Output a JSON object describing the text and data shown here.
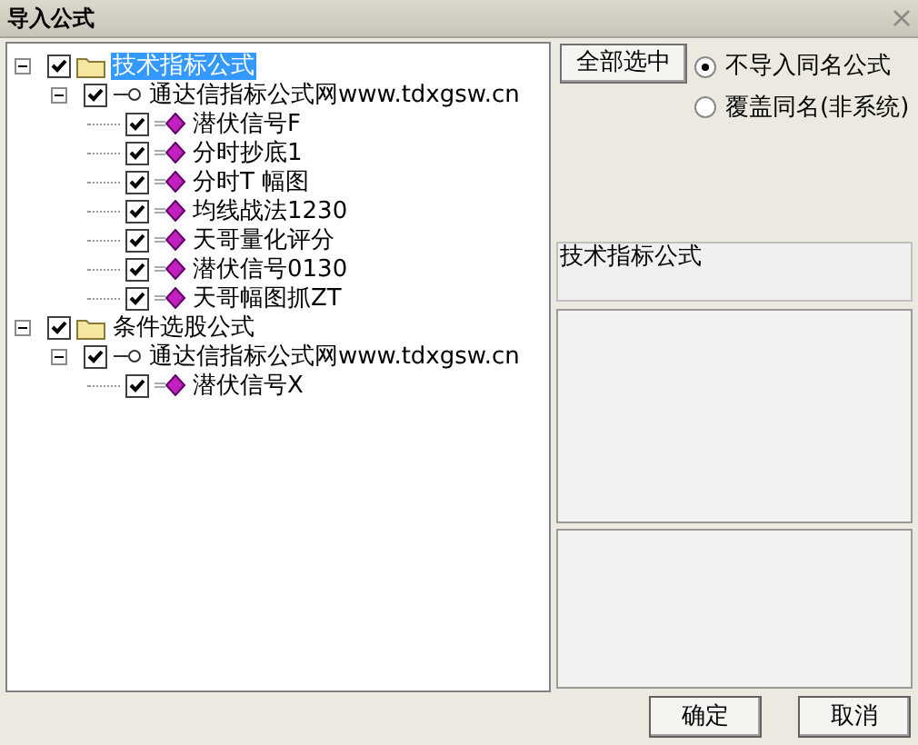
{
  "window": {
    "title": "导入公式"
  },
  "tree": [
    {
      "kind": "folder",
      "label": "技术指标公式",
      "checked": true,
      "expanded": true,
      "selected": true,
      "children": [
        {
          "kind": "group",
          "label": "通达信指标公式网www.tdxgsw.cn",
          "checked": true,
          "expanded": true,
          "selected": false,
          "children": [
            {
              "kind": "formula",
              "label": "潜伏信号F",
              "checked": true,
              "selected": false
            },
            {
              "kind": "formula",
              "label": "分时抄底1",
              "checked": true,
              "selected": false
            },
            {
              "kind": "formula",
              "label": "分时T 幅图",
              "checked": true,
              "selected": false
            },
            {
              "kind": "formula",
              "label": "均线战法1230",
              "checked": true,
              "selected": false
            },
            {
              "kind": "formula",
              "label": "天哥量化评分",
              "checked": true,
              "selected": false
            },
            {
              "kind": "formula",
              "label": "潜伏信号0130",
              "checked": true,
              "selected": false
            },
            {
              "kind": "formula",
              "label": "天哥幅图抓ZT",
              "checked": true,
              "selected": false
            }
          ]
        }
      ]
    },
    {
      "kind": "folder",
      "label": "条件选股公式",
      "checked": true,
      "expanded": true,
      "selected": false,
      "children": [
        {
          "kind": "group",
          "label": "通达信指标公式网www.tdxgsw.cn",
          "checked": true,
          "expanded": true,
          "selected": false,
          "children": [
            {
              "kind": "formula",
              "label": "潜伏信号X",
              "checked": true,
              "selected": false
            }
          ]
        }
      ]
    }
  ],
  "select_all_button": "全部选中",
  "radios": [
    {
      "label": "不导入同名公式",
      "selected": true
    },
    {
      "label": "覆盖同名(非系统)",
      "selected": false
    }
  ],
  "info_box": "技术指标公式",
  "buttons": [
    "确定",
    "取消"
  ]
}
